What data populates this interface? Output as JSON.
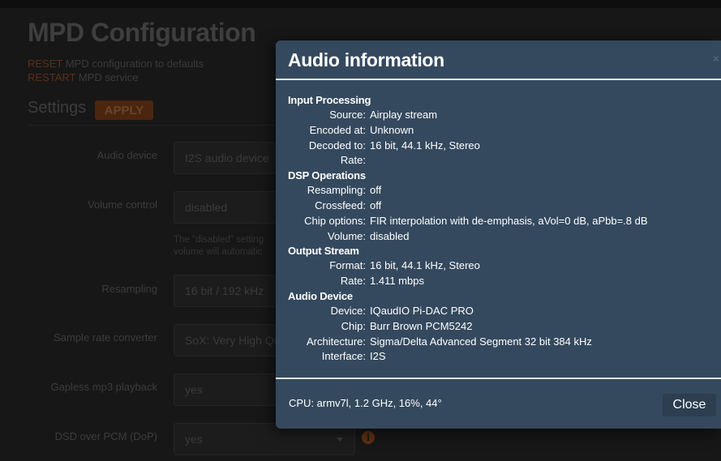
{
  "background": {
    "title": "MPD Configuration",
    "reset_link": "RESET",
    "reset_text": " MPD configuration to defaults",
    "restart_link": "RESTART",
    "restart_text": " MPD service",
    "settings_title": "Settings",
    "apply_label": "APPLY",
    "help_line1": "The \"disabled\" setting",
    "help_line2": "volume will automatic",
    "settings": [
      {
        "label": "Audio device",
        "value": "I2S audio device"
      },
      {
        "label": "Volume control",
        "value": "disabled"
      },
      {
        "label": "Resampling",
        "value": "16 bit / 192 kHz"
      },
      {
        "label": "Sample rate converter",
        "value": "SoX: Very High Qu"
      },
      {
        "label": "Gapless mp3 playback",
        "value": "yes"
      },
      {
        "label": "DSD over PCM (DoP)",
        "value": "yes"
      }
    ]
  },
  "modal": {
    "title": "Audio information",
    "close_x": "×",
    "cpu": "CPU: armv7l, 1.2 GHz, 16%, 44°",
    "close_label": "Close",
    "sections": [
      {
        "heading": "Input Processing",
        "rows": [
          {
            "key": "Source:",
            "value": "Airplay stream"
          },
          {
            "key": "Encoded at:",
            "value": "Unknown"
          },
          {
            "key": "Decoded to:",
            "value": "16 bit, 44.1 kHz, Stereo"
          },
          {
            "key": "Rate:",
            "value": ""
          }
        ]
      },
      {
        "heading": "DSP Operations",
        "rows": [
          {
            "key": "Resampling:",
            "value": "off"
          },
          {
            "key": "Crossfeed:",
            "value": "off"
          },
          {
            "key": "Chip options:",
            "value": "FIR interpolation with de-emphasis, aVol=0 dB, aPbb=.8 dB"
          },
          {
            "key": "Volume:",
            "value": "disabled"
          }
        ]
      },
      {
        "heading": "Output Stream",
        "rows": [
          {
            "key": "Format:",
            "value": "16 bit, 44.1 kHz, Stereo"
          },
          {
            "key": "Rate:",
            "value": "1.411 mbps"
          }
        ]
      },
      {
        "heading": "Audio Device",
        "rows": [
          {
            "key": "Device:",
            "value": "IQaudIO Pi-DAC PRO"
          },
          {
            "key": "Chip:",
            "value": "Burr Brown PCM5242"
          },
          {
            "key": "Architecture:",
            "value": "Sigma/Delta Advanced Segment 32 bit 384 kHz"
          },
          {
            "key": "Interface:",
            "value": "I2S"
          }
        ]
      }
    ]
  }
}
